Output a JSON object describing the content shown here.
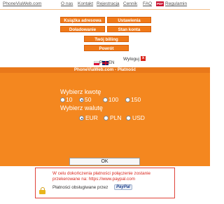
{
  "nav": {
    "links": [
      "PhoneViaWeb.com",
      "O nas",
      "Kontakt",
      "Rejestracja",
      "Cennik",
      "FAQ"
    ],
    "pdf_badge": "PDF",
    "regulamin": "Regulamin"
  },
  "menu": {
    "address_book": "Książka adresowa",
    "settings": "Ustawienia",
    "top_up": "Doładowanie",
    "account_status": "Stan konta",
    "your_billing": "Twój billing",
    "back": "Powrót"
  },
  "languages": {
    "pl_label": "PL",
    "en_label": "EN"
  },
  "logout": {
    "label": "Wyloguj",
    "icon_text": "x"
  },
  "panel": {
    "title": "PhoneViaWeb.com - Płatność",
    "amount_label": "Wybierz kwotę",
    "amounts": [
      "10",
      "50",
      "100",
      "150"
    ],
    "selected_amount": "50",
    "currency_label": "Wybierz walutę",
    "currencies": [
      "EUR",
      "PLN",
      "USD"
    ],
    "selected_currency": "EUR",
    "ok_button": "OK"
  },
  "info": {
    "line1": "W celu dokończenia płatności połączenie zostanie",
    "line2": "przekerowane na: https://www.paypal.com",
    "line3": "Płatności obsługiwane przez",
    "paypal_logo": "PayPal"
  },
  "colors": {
    "accent": "#f07a1a",
    "panel": "#f4871f",
    "info_border": "#e0443a",
    "info_text": "#d9261c"
  }
}
